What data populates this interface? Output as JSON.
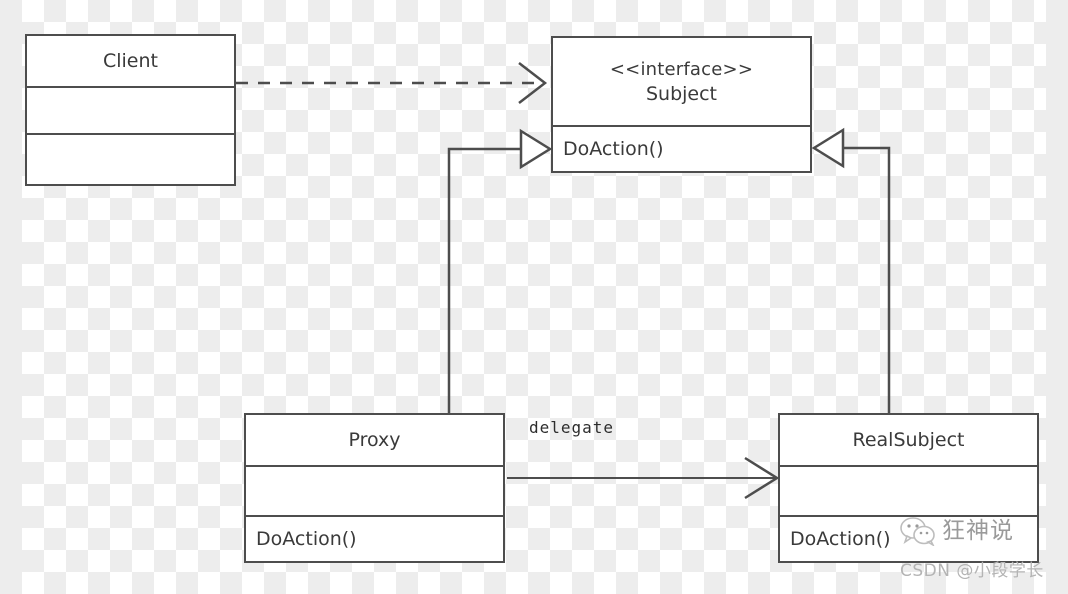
{
  "diagram": {
    "title": "Proxy Pattern UML Class Diagram",
    "type": "uml-class-diagram",
    "stroke_color": "#4d4d4d",
    "text_color": "#3a3a3a",
    "background": "transparent-checkerboard"
  },
  "classes": {
    "client": {
      "name": "Client",
      "stereotype": "",
      "attributes": "",
      "operations": ""
    },
    "subject": {
      "stereotype": "<<interface>>",
      "name": "Subject",
      "operations": "DoAction()"
    },
    "proxy": {
      "name": "Proxy",
      "attributes": "",
      "operations": "DoAction()"
    },
    "realsubject": {
      "name": "RealSubject",
      "attributes": "",
      "operations": "DoAction()"
    }
  },
  "relationships": {
    "client_to_subject": {
      "label": "",
      "kind": "dependency",
      "style": "dashed-open-arrow"
    },
    "proxy_realizes_subject": {
      "label": "",
      "kind": "realization",
      "style": "solid-hollow-triangle"
    },
    "realsubject_realizes_subject": {
      "label": "",
      "kind": "realization",
      "style": "solid-hollow-triangle"
    },
    "proxy_to_realsubject": {
      "label": "delegate",
      "kind": "association",
      "style": "solid-open-arrow"
    }
  },
  "watermark": {
    "logo": "wechat-icon",
    "account": "狂神说",
    "credit": "CSDN @小段学长"
  }
}
